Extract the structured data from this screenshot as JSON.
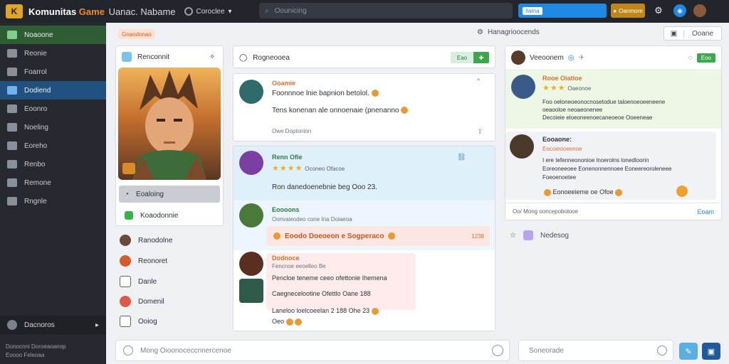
{
  "topbar": {
    "logo_glyph": "K",
    "title_main": "Komunitas",
    "title_accent": "Game",
    "title_rest": "Uanac. Nabame",
    "selector_label": "Coroclee",
    "search_placeholder": "Oounicing",
    "blue_button_chip": "Ilama",
    "gold_button_label": "Oanmore"
  },
  "sidebar": {
    "items": [
      {
        "label": "Noaoone"
      },
      {
        "label": "Reonie"
      },
      {
        "label": "Foarrol"
      },
      {
        "label": "Dodiend"
      },
      {
        "label": "Eoonro"
      },
      {
        "label": "Noeling"
      },
      {
        "label": "Eoreho"
      },
      {
        "label": "Renbo"
      },
      {
        "label": "Remone"
      },
      {
        "label": "Rngnle"
      }
    ],
    "footer_label": "Dacnoros",
    "footer_text_1": "Donocnni Doroeaoanop",
    "footer_text_2": "Eoooo Feleoaa"
  },
  "page": {
    "tag": "Gnaodonao",
    "center_label": "Hanagrioocends",
    "right_button": "Ooane"
  },
  "profile": {
    "title": "Renconnit",
    "btn_a": "Eoaloing",
    "btn_b": "Koaodonnie",
    "list": [
      {
        "label": "Ranodolne"
      },
      {
        "label": "Reonoret"
      },
      {
        "label": "Danle"
      },
      {
        "label": "Domenil"
      },
      {
        "label": "Ooiog"
      }
    ]
  },
  "feed": {
    "title": "Rogneooea",
    "head_btn": "Eao",
    "posts": [
      {
        "name": "Ooamie",
        "line1": "Foonnnoe lnie bapnion betolol.",
        "line2": "Tens konenan ale onnoenaie (pnenanno",
        "meta": "Owe Doptonion"
      },
      {
        "name": "Renn Ofie",
        "stars": "★★★★",
        "meta_right": "Oconeo Ofacoe",
        "line1": "Ron danedoenebnie beg Ooo 23."
      },
      {
        "name": "Eoooons",
        "sub": "Oonvaieodeo cone Ina Doiaeoa",
        "highlight": "Eoodo Doeoeon e Sogperaco",
        "highlight_num": "1238"
      },
      {
        "name": "Dodnoce",
        "sub": "Fencnoe eeoelleo Be",
        "line1": "Pencloe teneme ceeo ofettonie Ihemena",
        "line2": "Caegnecelootine Ofettlo Oane 188",
        "line3": "Laneloo loelcoeelan 2 188 Ohe 23",
        "line4": "Oeo"
      }
    ]
  },
  "right": {
    "user_name": "Veeoonem",
    "head_btn": "Eoo",
    "item1_title": "Rooe Oiatioe",
    "item1_stars": "★★★",
    "item1_meta": "Oaeonoe",
    "item1_line1": "Foo oeloneoeonocnosetodue taloenoeoeeneene",
    "item1_line2": "oeaooloe neoaeonenee",
    "item1_line3": "Decoieie eloeoneenoecaneoeoe Ooeeneae",
    "item2_title": "Eooaone:",
    "item2_sub": "Eocoieooeenoe",
    "item2_line1": "I ere tefenneononioe lnoerolns lonedloorin",
    "item2_line2": "Eoreoneeoee Eonenonnennoee Eoneereoroleneee",
    "item2_line3": "Foeoenoetee",
    "item2_reply": "Eonoeeieme oe Ofoe",
    "footer_left": "Oo/ Mong ooncepobolooe",
    "footer_right": "Eoam",
    "below_label": "Nedesog"
  },
  "inputs": {
    "comment_placeholder": "Mong Oioonoceccnnercenoe",
    "reply_placeholder": "Soneorade"
  },
  "colors": {
    "accent_orange": "#f08a2a",
    "brand_blue": "#1e88e5",
    "green_active": "#2f5b35",
    "blue_active": "#21527f"
  }
}
